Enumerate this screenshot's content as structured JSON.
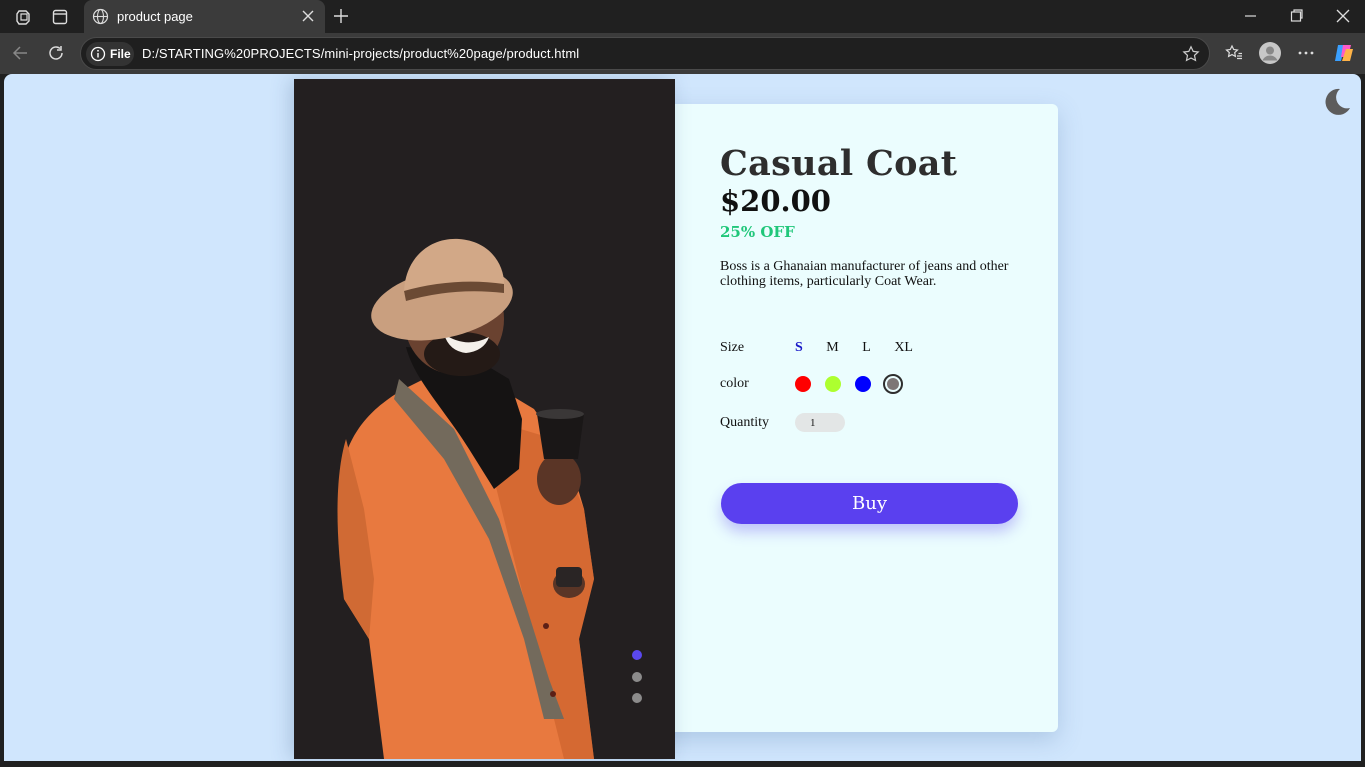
{
  "browser": {
    "tab_title": "product page",
    "site_label": "File",
    "url": "D:/STARTING%20PROJECTS/mini-projects/product%20page/product.html"
  },
  "product": {
    "title": "Casual Coat",
    "price": "$20.00",
    "discount": "25% OFF",
    "description": "Boss is a Ghanaian manufacturer of jeans and other clothing items, particularly Coat Wear.",
    "size_label": "Size",
    "sizes": [
      "S",
      "M",
      "L",
      "XL"
    ],
    "selected_size": "S",
    "color_label": "color",
    "colors": [
      "#ff0000",
      "#adff2f",
      "#0000ff",
      "#7d7676"
    ],
    "selected_color": "#7d7676",
    "quantity_label": "Quantity",
    "quantity_value": "1",
    "buy_label": "Buy"
  },
  "carousel": {
    "slides": 3,
    "active_index": 0
  },
  "theme": {
    "accent": "#5a40ef",
    "discount": "#20c77a",
    "page_bg": "#d0e6fd",
    "card_bg": "#ebfdfe",
    "image_bg": "#231f20"
  }
}
